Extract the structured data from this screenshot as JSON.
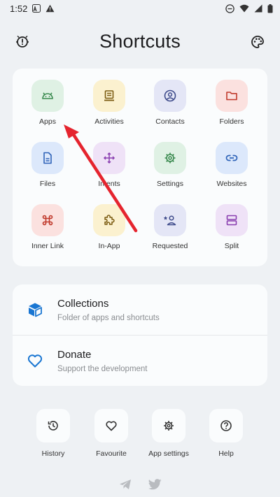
{
  "status_bar": {
    "time": "1:52"
  },
  "header": {
    "title": "Shortcuts"
  },
  "grid": [
    {
      "label": "Apps",
      "icon": "android-icon",
      "bg": "#dff1e4",
      "fg": "#3a8a4f"
    },
    {
      "label": "Activities",
      "icon": "activities-icon",
      "bg": "#fbf1cf",
      "fg": "#7a5a10"
    },
    {
      "label": "Contacts",
      "icon": "contacts-icon",
      "bg": "#e4e6f6",
      "fg": "#3d4a8a"
    },
    {
      "label": "Folders",
      "icon": "folder-icon",
      "bg": "#fbe1df",
      "fg": "#c0392b"
    },
    {
      "label": "Files",
      "icon": "file-icon",
      "bg": "#dce8fb",
      "fg": "#2f63b8"
    },
    {
      "label": "Intents",
      "icon": "intents-icon",
      "bg": "#efe2f7",
      "fg": "#8a3fb0"
    },
    {
      "label": "Settings",
      "icon": "settings-icon",
      "bg": "#dff1e4",
      "fg": "#3a8a4f"
    },
    {
      "label": "Websites",
      "icon": "link-icon",
      "bg": "#dce8fb",
      "fg": "#2f63b8"
    },
    {
      "label": "Inner Link",
      "icon": "command-icon",
      "bg": "#fbe1df",
      "fg": "#c0392b"
    },
    {
      "label": "In-App",
      "icon": "extension-icon",
      "bg": "#fbf1cf",
      "fg": "#7a5a10"
    },
    {
      "label": "Requested",
      "icon": "person-star-icon",
      "bg": "#e4e6f6",
      "fg": "#3d4a8a"
    },
    {
      "label": "Split",
      "icon": "split-icon",
      "bg": "#efe2f7",
      "fg": "#8a3fb0"
    }
  ],
  "list": [
    {
      "title": "Collections",
      "subtitle": "Folder of apps and shortcuts",
      "icon": "collection-icon"
    },
    {
      "title": "Donate",
      "subtitle": "Support the development",
      "icon": "heart-icon"
    }
  ],
  "bottom": [
    {
      "label": "History",
      "icon": "history-icon"
    },
    {
      "label": "Favourite",
      "icon": "heart-icon"
    },
    {
      "label": "App settings",
      "icon": "gear-icon"
    },
    {
      "label": "Help",
      "icon": "help-icon"
    }
  ],
  "colors": {
    "background": "#eef1f4",
    "card": "#fafcfd",
    "accent": "#1976d2",
    "annotation_arrow": "#e5242e"
  }
}
